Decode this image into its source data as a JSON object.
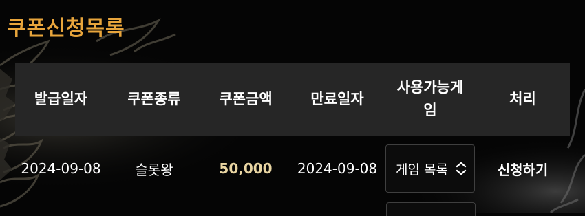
{
  "page": {
    "title": "쿠폰신청목록"
  },
  "table": {
    "headers": {
      "issue_date": "발급일자",
      "coupon_type": "쿠폰종류",
      "coupon_amount": "쿠폰금액",
      "expiry_date": "만료일자",
      "available_games": "사용가능게임",
      "action": "처리"
    },
    "rows": [
      {
        "issue_date": "2024-09-08",
        "coupon_type": "슬롯왕",
        "coupon_amount": "50,000",
        "expiry_date": "2024-09-08",
        "game_select_value": "게임 목록",
        "action_label": "신청하기"
      }
    ]
  },
  "colors": {
    "title": "#e8a53c",
    "amount": "#e9d5a2",
    "header_bg": "#262626",
    "page_bg": "#050505"
  },
  "icons": {
    "select_arrows": "chevron-up-down-icon"
  }
}
